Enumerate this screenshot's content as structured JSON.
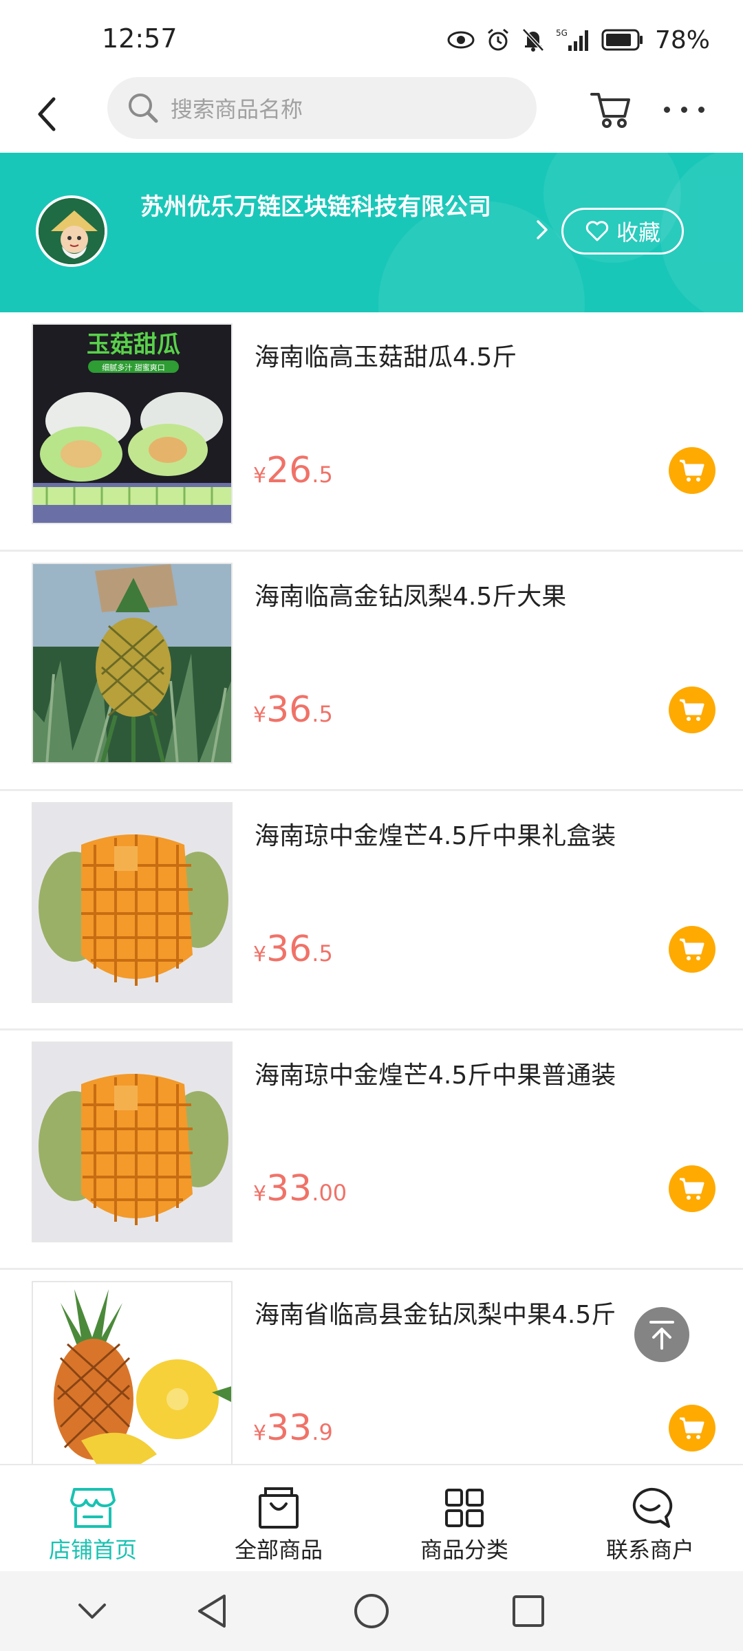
{
  "status_bar": {
    "time": "12:57",
    "network": "5G",
    "battery": "78%"
  },
  "nav": {
    "search_placeholder": "搜索商品名称"
  },
  "shop": {
    "name": "苏州优乐万链区块链科技有限公司",
    "favorite_label": "收藏",
    "banner_color": "#19c7b9"
  },
  "products": [
    {
      "title": "海南临高玉菇甜瓜4.5斤",
      "price_symbol": "¥",
      "price_int": "26",
      "price_dec": ".5",
      "image": "melon",
      "image_text": "玉菇甜瓜",
      "image_subtext": "细腻多汁 甜蜜爽口"
    },
    {
      "title": "海南临高金钻凤梨4.5斤大果",
      "price_symbol": "¥",
      "price_int": "36",
      "price_dec": ".5",
      "image": "pineapple-field"
    },
    {
      "title": "海南琼中金煌芒4.5斤中果礼盒装",
      "price_symbol": "¥",
      "price_int": "36",
      "price_dec": ".5",
      "image": "mango"
    },
    {
      "title": "海南琼中金煌芒4.5斤中果普通装",
      "price_symbol": "¥",
      "price_int": "33",
      "price_dec": ".00",
      "image": "mango"
    },
    {
      "title": "海南省临高县金钻凤梨中果4.5斤",
      "price_symbol": "¥",
      "price_int": "33",
      "price_dec": ".9",
      "image": "pineapple-cut"
    }
  ],
  "tabs": [
    {
      "label": "店铺首页",
      "icon": "store-icon",
      "active": true
    },
    {
      "label": "全部商品",
      "icon": "shopping-bag-icon",
      "active": false
    },
    {
      "label": "商品分类",
      "icon": "grid-icon",
      "active": false
    },
    {
      "label": "联系商户",
      "icon": "chat-icon",
      "active": false
    }
  ],
  "colors": {
    "accent": "#19c2b2",
    "price": "#f07268",
    "cart_button": "#ffaa00"
  }
}
